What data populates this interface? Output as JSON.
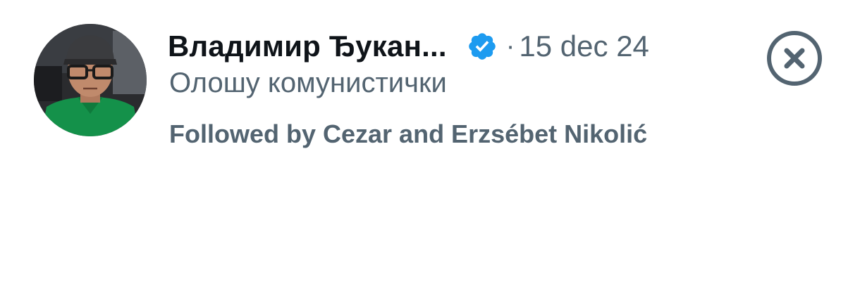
{
  "account": {
    "name": "Владимир Ђукан...",
    "verified_icon": "verified-badge-icon",
    "separator": "·",
    "date": "15 dec 24",
    "bio": "Олошу комунистички",
    "followed_by": "Followed by Cezar and Erzsébet Nikolić"
  },
  "actions": {
    "dismiss_icon": "close-circle-icon"
  },
  "colors": {
    "text_primary": "#0f1419",
    "text_secondary": "#536471",
    "verified_blue": "#1d9bf0"
  }
}
